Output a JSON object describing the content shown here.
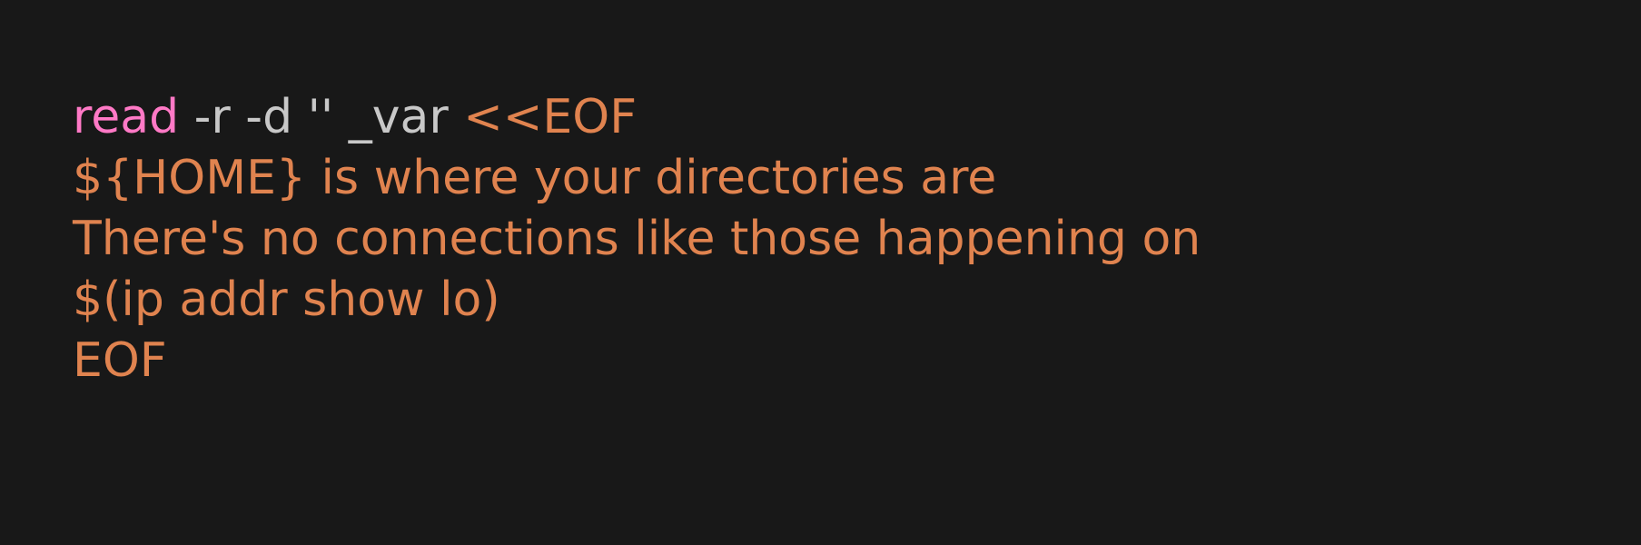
{
  "theme": {
    "background": "#181818",
    "keyword_color": "#ff79c6",
    "plain_color": "#c8c8c8",
    "heredoc_color": "#e0834f"
  },
  "code": {
    "lines": [
      {
        "tokens": [
          {
            "text": "read",
            "kind": "keyword"
          },
          {
            "text": " -r -d '' _var ",
            "kind": "plain"
          },
          {
            "text": "<<EOF",
            "kind": "string"
          }
        ]
      },
      {
        "tokens": [
          {
            "text": "${HOME} is where your directories are",
            "kind": "string"
          }
        ]
      },
      {
        "tokens": [
          {
            "text": "There's no connections like those happening on",
            "kind": "string"
          }
        ]
      },
      {
        "tokens": [
          {
            "text": "$(ip addr show lo)",
            "kind": "string"
          }
        ]
      },
      {
        "tokens": [
          {
            "text": "EOF",
            "kind": "string"
          }
        ]
      }
    ]
  }
}
